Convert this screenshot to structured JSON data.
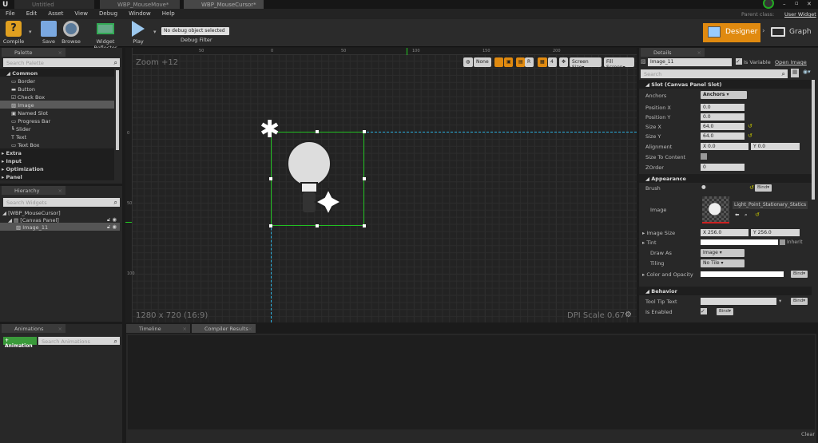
{
  "title_tabs": [
    {
      "label": "Untitled"
    },
    {
      "label": "WBP_MouseMove*"
    },
    {
      "label": "WBP_MouseCursor*"
    }
  ],
  "window_controls": {
    "minimize": "–",
    "maximize": "▫",
    "close": "✕"
  },
  "parent_class": {
    "label": "Parent class:",
    "value": "User Widget"
  },
  "menu": [
    "File",
    "Edit",
    "Asset",
    "View",
    "Debug",
    "Window",
    "Help"
  ],
  "toolbar": {
    "compile": "Compile",
    "save": "Save",
    "browse": "Browse",
    "widget_reflector": "Widget Reflector",
    "play": "Play",
    "debug_select": "No debug object selected",
    "debug_filter": "Debug Filter"
  },
  "mode": {
    "designer": "Designer",
    "graph": "Graph"
  },
  "palette": {
    "tab": "Palette",
    "search_placeholder": "Search Palette",
    "categories": [
      {
        "label": "Common"
      },
      {
        "label": "Extra"
      },
      {
        "label": "Input"
      },
      {
        "label": "Optimization"
      },
      {
        "label": "Panel"
      }
    ],
    "common_items": [
      "Border",
      "Button",
      "Check Box",
      "Image",
      "Named Slot",
      "Progress Bar",
      "Slider",
      "Text",
      "Text Box"
    ],
    "selected": "Image"
  },
  "hierarchy": {
    "tab": "Hierarchy",
    "search_placeholder": "Search Widgets",
    "items": [
      "[WBP_MouseCursor]",
      "[Canvas Panel]",
      "Image_11"
    ]
  },
  "viewport": {
    "zoom": "Zoom +12",
    "resolution": "1280 x 720 (16:9)",
    "dpi_scale": "DPI Scale 0.67",
    "toolbar": {
      "none": "None",
      "r": "R",
      "grid_size": "4",
      "screen_size": "Screen Size",
      "fill_screen": "Fill Screen"
    },
    "ruler_top": [
      "50",
      "0",
      "50",
      "100",
      "150",
      "200"
    ],
    "ruler_left": [
      "0",
      "50",
      "100"
    ],
    "selection_color": "#22c022",
    "guide_color": "#2ab0e0"
  },
  "details": {
    "tab": "Details",
    "name": "Image_11",
    "is_variable": "Is Variable",
    "open_image": "Open Image",
    "search_placeholder": "Search",
    "slot": {
      "header": "Slot (Canvas Panel Slot)",
      "anchors_label": "Anchors",
      "anchors_value": "Anchors",
      "position_x_label": "Position X",
      "position_x": "0.0",
      "position_y_label": "Position Y",
      "position_y": "0.0",
      "size_x_label": "Size X",
      "size_x": "64.0",
      "size_y_label": "Size Y",
      "size_y": "64.0",
      "alignment_label": "Alignment",
      "alignment_x": "X  0.0",
      "alignment_y": "Y  0.0",
      "size_to_content_label": "Size To Content",
      "zorder_label": "ZOrder",
      "zorder": "0"
    },
    "appearance": {
      "header": "Appearance",
      "brush_label": "Brush",
      "bind": "Bind",
      "image_label": "Image",
      "image_asset": "Light_Point_Stationary_Statics",
      "image_size_label": "Image Size",
      "image_size_x": "X  256.0",
      "image_size_y": "Y  256.0",
      "tint_label": "Tint",
      "inherit": "Inherit",
      "draw_as_label": "Draw As",
      "draw_as": "Image",
      "tiling_label": "Tiling",
      "tiling": "No Tile",
      "color_opacity_label": "Color and Opacity"
    },
    "behavior": {
      "header": "Behavior",
      "tooltip_label": "Tool Tip Text",
      "is_enabled_label": "Is Enabled"
    }
  },
  "animations": {
    "tab": "Animations",
    "add": "+ Animation",
    "search_placeholder": "Search Animations"
  },
  "bottom_tabs": [
    "Timeline",
    "Compiler Results"
  ],
  "clear": "Clear",
  "accent": "#e08a10"
}
